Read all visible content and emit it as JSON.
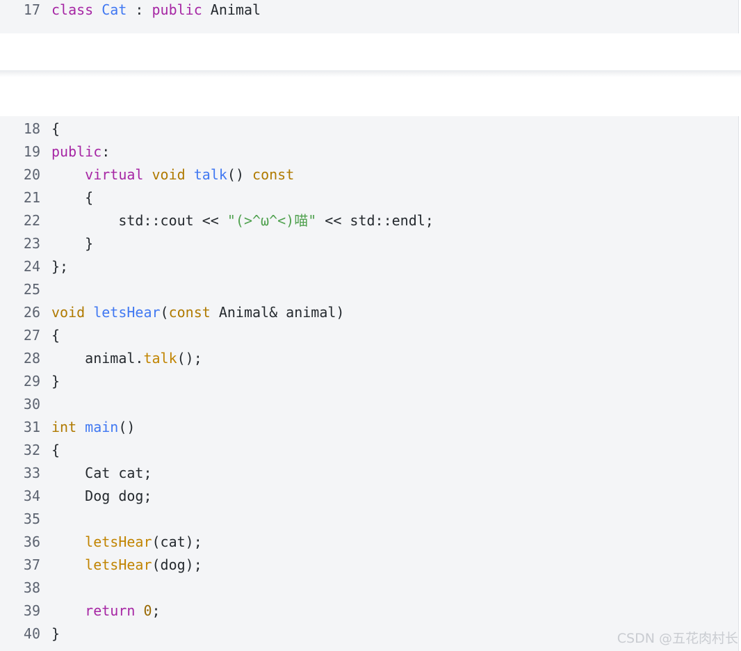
{
  "top_block": {
    "lines": [
      {
        "number": "17",
        "tokens": [
          {
            "text": "class",
            "kind": "keyword"
          },
          {
            "text": " ",
            "kind": "plain"
          },
          {
            "text": "Cat",
            "kind": "title"
          },
          {
            "text": " : ",
            "kind": "plain"
          },
          {
            "text": "public",
            "kind": "keyword"
          },
          {
            "text": " Animal",
            "kind": "plain"
          }
        ]
      }
    ]
  },
  "main_block": {
    "lines": [
      {
        "number": "18",
        "tokens": [
          {
            "text": "{",
            "kind": "plain"
          }
        ]
      },
      {
        "number": "19",
        "tokens": [
          {
            "text": "public",
            "kind": "keyword"
          },
          {
            "text": ":",
            "kind": "plain"
          }
        ]
      },
      {
        "number": "20",
        "tokens": [
          {
            "text": "    ",
            "kind": "plain"
          },
          {
            "text": "virtual",
            "kind": "keyword"
          },
          {
            "text": " ",
            "kind": "plain"
          },
          {
            "text": "void",
            "kind": "type"
          },
          {
            "text": " ",
            "kind": "plain"
          },
          {
            "text": "talk",
            "kind": "func"
          },
          {
            "text": "() ",
            "kind": "plain"
          },
          {
            "text": "const",
            "kind": "type"
          }
        ]
      },
      {
        "number": "21",
        "tokens": [
          {
            "text": "    {",
            "kind": "plain"
          }
        ]
      },
      {
        "number": "22",
        "tokens": [
          {
            "text": "        std::cout << ",
            "kind": "plain"
          },
          {
            "text": "\"(>^ω^<)喵\"",
            "kind": "string"
          },
          {
            "text": " << std::endl;",
            "kind": "plain"
          }
        ]
      },
      {
        "number": "23",
        "tokens": [
          {
            "text": "    }",
            "kind": "plain"
          }
        ]
      },
      {
        "number": "24",
        "tokens": [
          {
            "text": "};",
            "kind": "plain"
          }
        ]
      },
      {
        "number": "25",
        "tokens": []
      },
      {
        "number": "26",
        "tokens": [
          {
            "text": "void",
            "kind": "type"
          },
          {
            "text": " ",
            "kind": "plain"
          },
          {
            "text": "letsHear",
            "kind": "func"
          },
          {
            "text": "(",
            "kind": "plain"
          },
          {
            "text": "const",
            "kind": "type"
          },
          {
            "text": " Animal& animal)",
            "kind": "plain"
          }
        ]
      },
      {
        "number": "27",
        "tokens": [
          {
            "text": "{",
            "kind": "plain"
          }
        ]
      },
      {
        "number": "28",
        "tokens": [
          {
            "text": "    animal.",
            "kind": "plain"
          },
          {
            "text": "talk",
            "kind": "call"
          },
          {
            "text": "();",
            "kind": "plain"
          }
        ]
      },
      {
        "number": "29",
        "tokens": [
          {
            "text": "}",
            "kind": "plain"
          }
        ]
      },
      {
        "number": "30",
        "tokens": []
      },
      {
        "number": "31",
        "tokens": [
          {
            "text": "int",
            "kind": "type"
          },
          {
            "text": " ",
            "kind": "plain"
          },
          {
            "text": "main",
            "kind": "func"
          },
          {
            "text": "()",
            "kind": "plain"
          }
        ]
      },
      {
        "number": "32",
        "tokens": [
          {
            "text": "{",
            "kind": "plain"
          }
        ]
      },
      {
        "number": "33",
        "tokens": [
          {
            "text": "    Cat cat;",
            "kind": "plain"
          }
        ]
      },
      {
        "number": "34",
        "tokens": [
          {
            "text": "    Dog dog;",
            "kind": "plain"
          }
        ]
      },
      {
        "number": "35",
        "tokens": []
      },
      {
        "number": "36",
        "tokens": [
          {
            "text": "    ",
            "kind": "plain"
          },
          {
            "text": "letsHear",
            "kind": "call"
          },
          {
            "text": "(cat);",
            "kind": "plain"
          }
        ]
      },
      {
        "number": "37",
        "tokens": [
          {
            "text": "    ",
            "kind": "plain"
          },
          {
            "text": "letsHear",
            "kind": "call"
          },
          {
            "text": "(dog);",
            "kind": "plain"
          }
        ]
      },
      {
        "number": "38",
        "tokens": []
      },
      {
        "number": "39",
        "tokens": [
          {
            "text": "    ",
            "kind": "plain"
          },
          {
            "text": "return",
            "kind": "keyword"
          },
          {
            "text": " ",
            "kind": "plain"
          },
          {
            "text": "0",
            "kind": "number"
          },
          {
            "text": ";",
            "kind": "plain"
          }
        ]
      },
      {
        "number": "40",
        "tokens": [
          {
            "text": "}",
            "kind": "plain"
          }
        ]
      }
    ]
  },
  "watermark": "CSDN @五花肉村长",
  "colors": {
    "code_background": "#f4f5f7",
    "line_number": "#5c6370",
    "keyword": "#a626a4",
    "type": "#b07a00",
    "function": "#4078f2",
    "call": "#c18401",
    "string": "#50a14f",
    "number": "#986801"
  }
}
